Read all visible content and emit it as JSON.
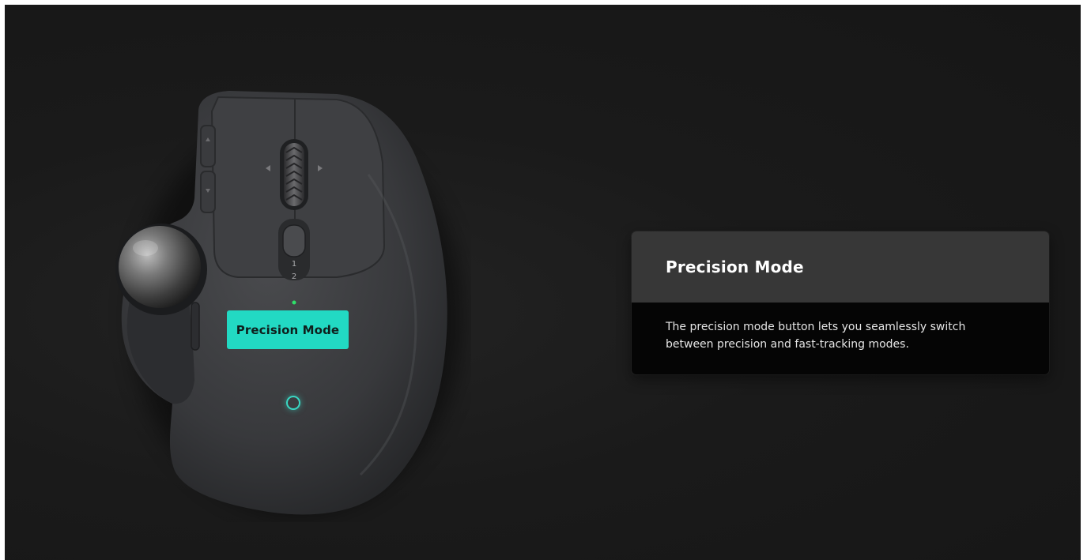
{
  "device": {
    "dpi_labels": [
      "1",
      "2"
    ],
    "accent_color": "#22d9c3"
  },
  "callout": {
    "label": "Precision Mode"
  },
  "info_card": {
    "title": "Precision Mode",
    "description": "The precision mode button lets you seamlessly switch between precision and fast-tracking modes."
  }
}
